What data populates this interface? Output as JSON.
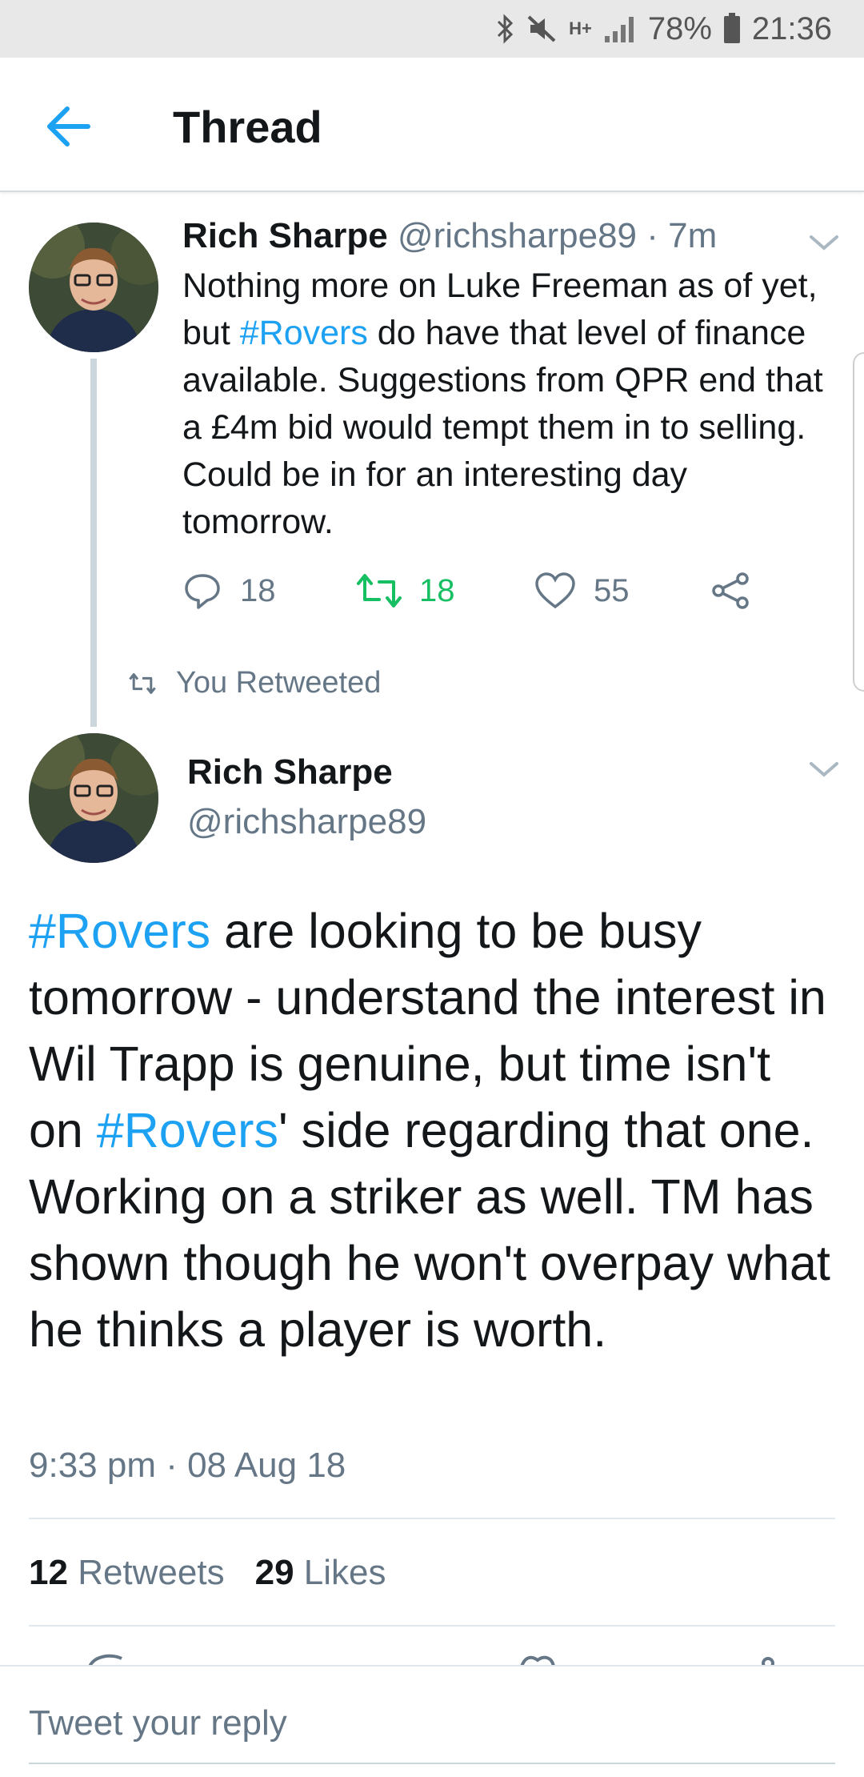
{
  "status_bar": {
    "network": "H+",
    "battery": "78%",
    "time": "21:36"
  },
  "header": {
    "title": "Thread"
  },
  "colors": {
    "accent": "#1da1f2",
    "retweet_green": "#17bf63",
    "muted": "#657786"
  },
  "tweet1": {
    "name": "Rich Sharpe",
    "handle": "@richsharpe89",
    "time": "· 7m",
    "text_before": "Nothing more on Luke Freeman as of yet, but ",
    "hashtag": "#Rovers",
    "text_after": " do have that level of finance available. Suggestions from QPR end that a £4m bid would tempt them in to selling. Could be in for an interesting day tomorrow.",
    "replies": "18",
    "retweets": "18",
    "likes": "55"
  },
  "retweet_notice": "You Retweeted",
  "tweet2": {
    "name": "Rich Sharpe",
    "handle": "@richsharpe89",
    "hashtag1": "#Rovers",
    "text_part1": " are looking to be busy tomorrow - understand the interest in Wil Trapp is genuine, but time isn't on ",
    "hashtag2": "#Rovers",
    "text_part2": "' side regarding that one. Working on a striker as well. TM has shown though he won't overpay what he thinks a player is worth.",
    "timestamp": "9:33 pm · 08 Aug 18",
    "retweet_count": "12",
    "retweet_label": "Retweets",
    "like_count": "29",
    "like_label": "Likes"
  },
  "reply": {
    "placeholder": "Tweet your reply"
  },
  "icons": [
    "bluetooth-icon",
    "mute-icon",
    "signal-icon",
    "battery-icon",
    "back-arrow-icon",
    "chevron-down-icon",
    "reply-icon",
    "retweet-icon",
    "like-icon",
    "share-icon"
  ]
}
